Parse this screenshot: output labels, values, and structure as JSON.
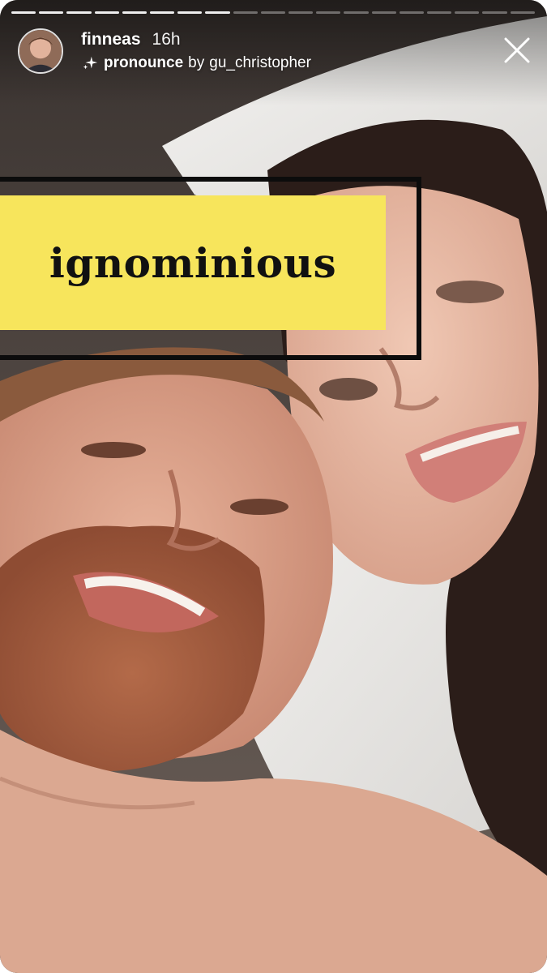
{
  "story": {
    "progress_segments": 19,
    "progress_completed": 8,
    "user": {
      "username": "finneas",
      "time_ago": "16h"
    },
    "effect": {
      "icon": "sparkle-icon",
      "name": "pronounce",
      "by_label": "by",
      "creator": "gu_christopher"
    },
    "close_icon": "close-icon",
    "word_card": {
      "word": "ignominious",
      "background_color": "#f7e55c",
      "frame_color": "#0c0c0c"
    }
  }
}
